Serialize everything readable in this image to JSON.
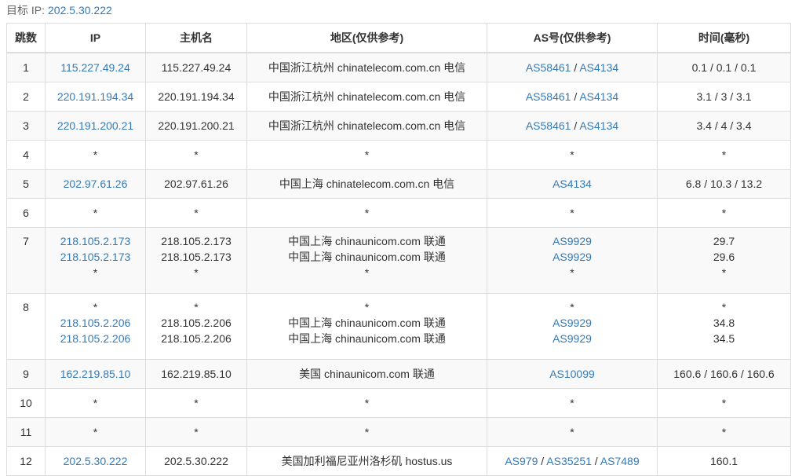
{
  "target": {
    "label": "目标 IP:",
    "ip": "202.5.30.222"
  },
  "headers": {
    "hop": "跳数",
    "ip": "IP",
    "host": "主机名",
    "region": "地区(仅供参考)",
    "as": "AS号(仅供参考)",
    "time": "时间(毫秒)"
  },
  "rows": [
    {
      "hop": "1",
      "ips": [
        "115.227.49.24"
      ],
      "hosts": [
        "115.227.49.24"
      ],
      "regions": [
        "中国浙江杭州 chinatelecom.com.cn 电信"
      ],
      "as": [
        [
          "AS58461",
          "AS4134"
        ]
      ],
      "times": [
        "0.1 / 0.1 / 0.1"
      ]
    },
    {
      "hop": "2",
      "ips": [
        "220.191.194.34"
      ],
      "hosts": [
        "220.191.194.34"
      ],
      "regions": [
        "中国浙江杭州 chinatelecom.com.cn 电信"
      ],
      "as": [
        [
          "AS58461",
          "AS4134"
        ]
      ],
      "times": [
        "3.1 / 3 / 3.1"
      ]
    },
    {
      "hop": "3",
      "ips": [
        "220.191.200.21"
      ],
      "hosts": [
        "220.191.200.21"
      ],
      "regions": [
        "中国浙江杭州 chinatelecom.com.cn 电信"
      ],
      "as": [
        [
          "AS58461",
          "AS4134"
        ]
      ],
      "times": [
        "3.4 / 4 / 3.4"
      ]
    },
    {
      "hop": "4",
      "ips": [
        "*"
      ],
      "hosts": [
        "*"
      ],
      "regions": [
        "*"
      ],
      "as": [
        [
          "*"
        ]
      ],
      "times": [
        "*"
      ]
    },
    {
      "hop": "5",
      "ips": [
        "202.97.61.26"
      ],
      "hosts": [
        "202.97.61.26"
      ],
      "regions": [
        "中国上海 chinatelecom.com.cn 电信"
      ],
      "as": [
        [
          "AS4134"
        ]
      ],
      "times": [
        "6.8 / 10.3 / 13.2"
      ]
    },
    {
      "hop": "6",
      "ips": [
        "*"
      ],
      "hosts": [
        "*"
      ],
      "regions": [
        "*"
      ],
      "as": [
        [
          "*"
        ]
      ],
      "times": [
        "*"
      ]
    },
    {
      "hop": "7",
      "ips": [
        "218.105.2.173",
        "218.105.2.173",
        "*"
      ],
      "hosts": [
        "218.105.2.173",
        "218.105.2.173",
        "*"
      ],
      "regions": [
        "中国上海 chinaunicom.com 联通",
        "中国上海 chinaunicom.com 联通",
        "*"
      ],
      "as": [
        [
          "AS9929"
        ],
        [
          "AS9929"
        ],
        [
          "*"
        ]
      ],
      "times": [
        "29.7",
        "29.6",
        "*"
      ]
    },
    {
      "hop": "8",
      "ips": [
        "*",
        "218.105.2.206",
        "218.105.2.206"
      ],
      "hosts": [
        "*",
        "218.105.2.206",
        "218.105.2.206"
      ],
      "regions": [
        "*",
        "中国上海 chinaunicom.com 联通",
        "中国上海 chinaunicom.com 联通"
      ],
      "as": [
        [
          "*"
        ],
        [
          "AS9929"
        ],
        [
          "AS9929"
        ]
      ],
      "times": [
        "*",
        "34.8",
        "34.5"
      ]
    },
    {
      "hop": "9",
      "ips": [
        "162.219.85.10"
      ],
      "hosts": [
        "162.219.85.10"
      ],
      "regions": [
        "美国 chinaunicom.com 联通"
      ],
      "as": [
        [
          "AS10099"
        ]
      ],
      "times": [
        "160.6 / 160.6 / 160.6"
      ]
    },
    {
      "hop": "10",
      "ips": [
        "*"
      ],
      "hosts": [
        "*"
      ],
      "regions": [
        "*"
      ],
      "as": [
        [
          "*"
        ]
      ],
      "times": [
        "*"
      ]
    },
    {
      "hop": "11",
      "ips": [
        "*"
      ],
      "hosts": [
        "*"
      ],
      "regions": [
        "*"
      ],
      "as": [
        [
          "*"
        ]
      ],
      "times": [
        "*"
      ]
    },
    {
      "hop": "12",
      "ips": [
        "202.5.30.222"
      ],
      "hosts": [
        "202.5.30.222"
      ],
      "regions": [
        "美国加利福尼亚州洛杉矶 hostus.us"
      ],
      "as": [
        [
          "AS979",
          "AS35251",
          "AS7489"
        ]
      ],
      "times": [
        "160.1"
      ]
    }
  ],
  "colors": {
    "link": "#337ab7",
    "border": "#dddddd",
    "stripe": "#f9f9f9"
  }
}
